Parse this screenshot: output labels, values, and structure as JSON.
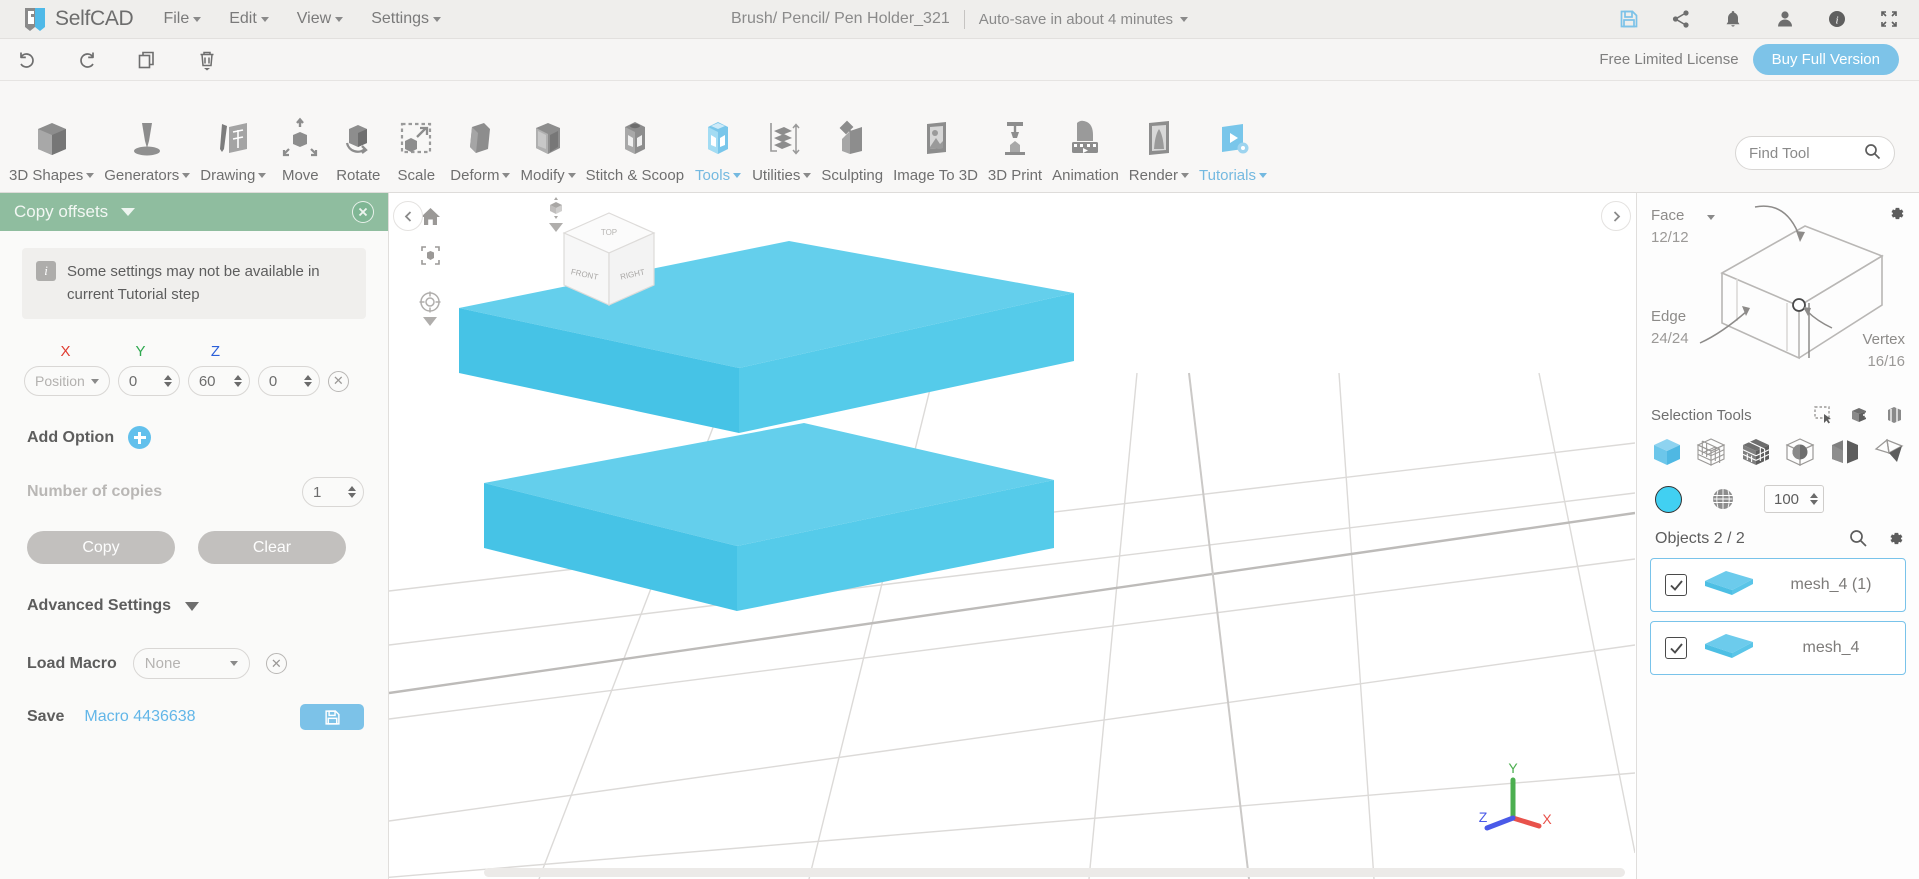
{
  "app": {
    "brand": "SelfCAD",
    "menu": [
      {
        "label": "File",
        "has_caret": true
      },
      {
        "label": "Edit",
        "has_caret": true
      },
      {
        "label": "View",
        "has_caret": true
      },
      {
        "label": "Settings",
        "has_caret": true
      }
    ],
    "document_title": "Brush/ Pencil/ Pen Holder_321",
    "autosave_text": "Auto-save in about 4 minutes",
    "top_icons": [
      "save-icon",
      "share-icon",
      "notifications-bell-icon",
      "user-account-icon",
      "info-icon",
      "fullscreen-icon"
    ],
    "accent_color": "#7dc3e8",
    "panel_header_color": "#8fbd9f"
  },
  "actionbar": {
    "tools": [
      "undo-icon",
      "redo-icon",
      "duplicate-icon",
      "delete-icon"
    ],
    "license_text": "Free Limited License",
    "buy_label": "Buy Full Version"
  },
  "ribbon": {
    "items": [
      {
        "label": "3D Shapes",
        "icon": "cube-icon",
        "caret": true,
        "active": false
      },
      {
        "label": "Generators",
        "icon": "generator-cone-icon",
        "caret": true,
        "active": false
      },
      {
        "label": "Drawing",
        "icon": "pencil-sketch-icon",
        "caret": true,
        "active": false
      },
      {
        "label": "Move",
        "icon": "move-arrows-icon",
        "caret": false,
        "active": false
      },
      {
        "label": "Rotate",
        "icon": "rotate-cube-icon",
        "caret": false,
        "active": false
      },
      {
        "label": "Scale",
        "icon": "scale-cube-icon",
        "caret": false,
        "active": false
      },
      {
        "label": "Deform",
        "icon": "deform-cube-icon",
        "caret": true,
        "active": false
      },
      {
        "label": "Modify",
        "icon": "modify-cube-icon",
        "caret": true,
        "active": false
      },
      {
        "label": "Stitch & Scoop",
        "icon": "stitch-scoop-icon",
        "caret": false,
        "active": false
      },
      {
        "label": "Tools",
        "icon": "tools-cube-icon",
        "caret": true,
        "active": true
      },
      {
        "label": "Utilities",
        "icon": "utilities-stack-icon",
        "caret": true,
        "active": false
      },
      {
        "label": "Sculpting",
        "icon": "sculpting-chisel-icon",
        "caret": false,
        "active": false
      },
      {
        "label": "Image To 3D",
        "icon": "image-to-3d-icon",
        "caret": false,
        "active": false
      },
      {
        "label": "3D Print",
        "icon": "3d-printer-icon",
        "caret": false,
        "active": false
      },
      {
        "label": "Animation",
        "icon": "animation-film-icon",
        "caret": false,
        "active": false
      },
      {
        "label": "Render",
        "icon": "render-icon",
        "caret": true,
        "active": false
      },
      {
        "label": "Tutorials",
        "icon": "tutorials-play-icon",
        "caret": true,
        "active": true
      }
    ],
    "find_tool_placeholder": "Find Tool",
    "find_tool_icon": "search-icon"
  },
  "left_panel": {
    "title": "Copy offsets",
    "close_icon": "close-circle-icon",
    "notice": "Some settings may not be available in current Tutorial step",
    "axes": {
      "x": "X",
      "y": "Y",
      "z": "Z"
    },
    "transform_mode": "Position",
    "offsets": {
      "x": "0",
      "y": "60",
      "z": "0"
    },
    "remove_icon": "remove-offset-icon",
    "add_option_label": "Add Option",
    "add_option_icon": "plus-circle-icon",
    "copies_label": "Number of copies",
    "copies_value": "1",
    "copy_button": "Copy",
    "clear_button": "Clear",
    "advanced_settings_label": "Advanced Settings",
    "load_macro_label": "Load Macro",
    "load_macro_value": "None",
    "macro_clear_icon": "clear-macro-icon",
    "save_label": "Save",
    "macro_name": "Macro 4436638",
    "save_icon": "floppy-save-icon"
  },
  "viewport": {
    "collapse_left_icon": "chevron-left-icon",
    "collapse_right_icon": "chevron-right-icon",
    "gizmos": [
      "home-icon",
      "fit-to-view-icon",
      "orbit-icon"
    ],
    "viewcube_faces": {
      "top": "TOP",
      "front": "FRONT",
      "right": "RIGHT"
    },
    "axis_labels": {
      "x": "X",
      "y": "Y",
      "z": "Z"
    },
    "axis_colors": {
      "x": "#e8524b",
      "y": "#4caf50",
      "z": "#4a5ae8"
    },
    "object_color": "#5bc8e8",
    "object_top_color": "#64cfec",
    "grid_color": "#d6d4d2"
  },
  "right_panel": {
    "gear_icon": "settings-gear-icon",
    "mode": "Face",
    "mode_caret_icon": "chevron-down-icon",
    "counts": {
      "face": "12/12",
      "edge": "24/24",
      "vertex": "16/16"
    },
    "labels": {
      "face": "Face",
      "edge": "Edge",
      "vertex": "Vertex"
    },
    "selection_tools_label": "Selection Tools",
    "selection_mini_icons": [
      "rectangle-select-icon",
      "box-select-add-icon",
      "through-select-icon"
    ],
    "selection_mode_icons": [
      "object-select-icon",
      "vertex-select-icon",
      "face-select-icon",
      "sphere-select-icon",
      "half-select-icon",
      "polygon-select-icon"
    ],
    "color_swatch": "#41d0f2",
    "texture_icon": "texture-sphere-icon",
    "opacity_value": "100",
    "objects_label": "Objects 2 / 2",
    "objects_search_icon": "search-icon",
    "objects_gear_icon": "settings-gear-icon",
    "objects": [
      {
        "name": "mesh_4 (1)",
        "checked": true,
        "thumb": "slab-thumb-icon"
      },
      {
        "name": "mesh_4",
        "checked": true,
        "thumb": "slab-thumb-icon"
      }
    ]
  }
}
